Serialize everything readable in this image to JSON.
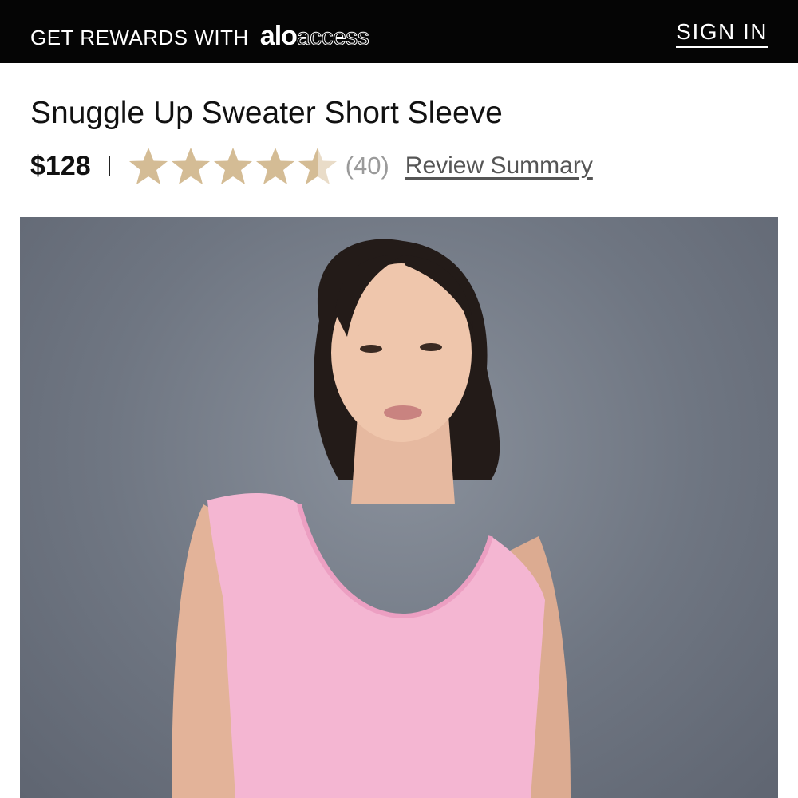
{
  "topbar": {
    "promo_text": "GET REWARDS WITH",
    "logo_alo": "alo",
    "logo_access": "access",
    "signin_label": "SIGN IN"
  },
  "product": {
    "title": "Snuggle Up Sweater Short Sleeve",
    "price": "$128",
    "rating": 4.5,
    "rating_max": 5,
    "review_count": "(40)",
    "review_summary_label": "Review Summary",
    "star_color": "#d4bc95",
    "image_icon": "product-photo-pink-sweater"
  },
  "colors": {
    "topbar_bg": "#050505",
    "sweater_pink": "#f4b6d2",
    "backdrop": "#6f7682"
  }
}
